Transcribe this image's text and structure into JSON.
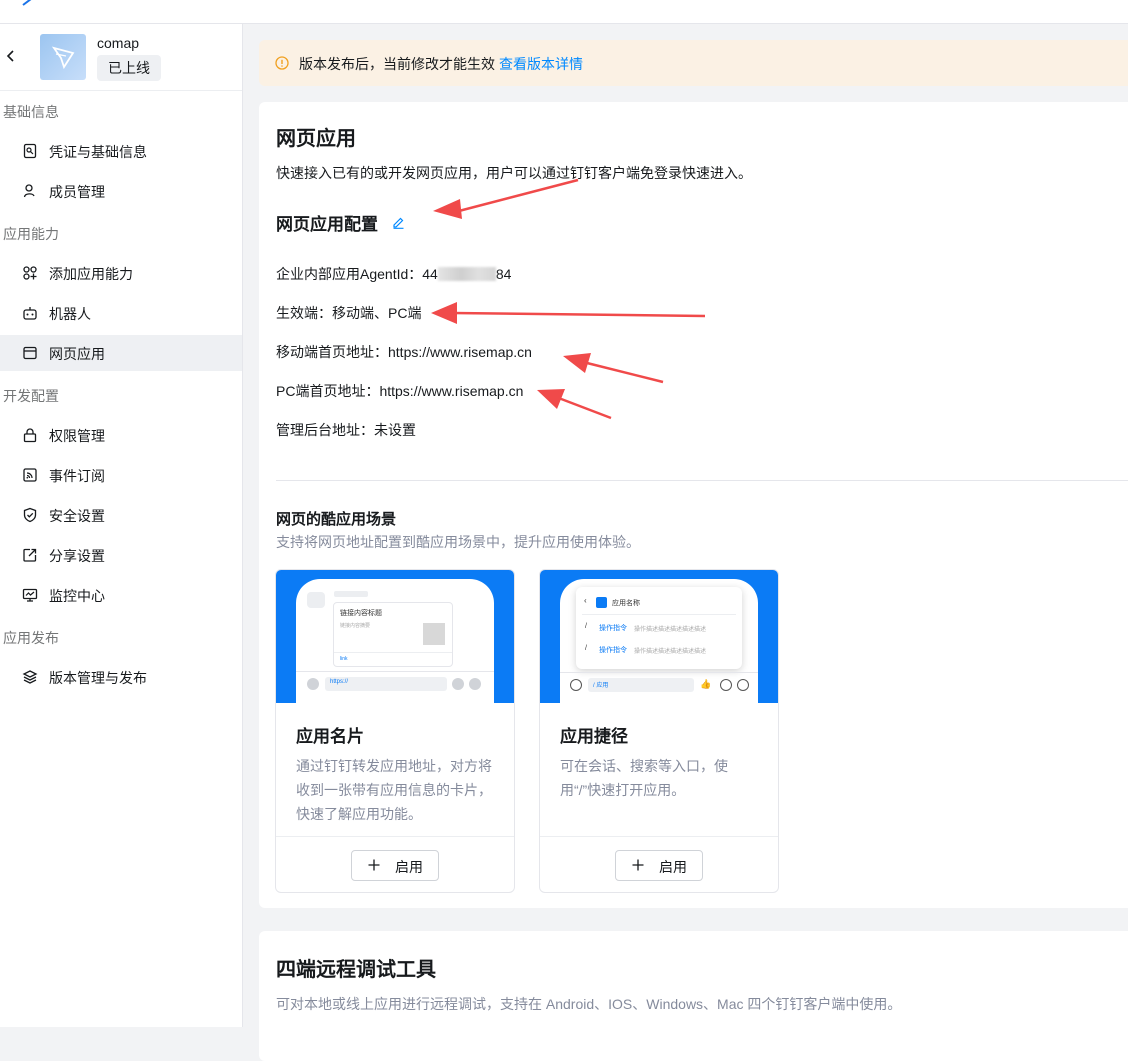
{
  "app": {
    "name": "comap",
    "status": "已上线"
  },
  "sidebar": {
    "sections": [
      {
        "title": "基础信息",
        "items": [
          {
            "label": "凭证与基础信息",
            "icon": "credential-icon"
          },
          {
            "label": "成员管理",
            "icon": "member-icon"
          }
        ]
      },
      {
        "title": "应用能力",
        "items": [
          {
            "label": "添加应用能力",
            "icon": "add-capability-icon"
          },
          {
            "label": "机器人",
            "icon": "robot-icon"
          },
          {
            "label": "网页应用",
            "icon": "web-app-icon",
            "active": true
          }
        ]
      },
      {
        "title": "开发配置",
        "items": [
          {
            "label": "权限管理",
            "icon": "lock-icon"
          },
          {
            "label": "事件订阅",
            "icon": "rss-icon"
          },
          {
            "label": "安全设置",
            "icon": "shield-icon"
          },
          {
            "label": "分享设置",
            "icon": "share-icon"
          },
          {
            "label": "监控中心",
            "icon": "monitor-icon"
          }
        ]
      },
      {
        "title": "应用发布",
        "items": [
          {
            "label": "版本管理与发布",
            "icon": "layers-icon"
          }
        ]
      }
    ]
  },
  "banner": {
    "text": "版本发布后，当前修改才能生效",
    "link": "查看版本详情"
  },
  "web_app": {
    "title": "网页应用",
    "description": "快速接入已有的或开发网页应用，用户可以通过钉钉客户端免登录快速进入。",
    "config_title": "网页应用配置",
    "agent_id_label": "企业内部应用AgentId：",
    "agent_id_prefix": "44",
    "agent_id_suffix": "84",
    "platform": "生效端：移动端、PC端",
    "mobile_url": "移动端首页地址：https://www.risemap.cn",
    "pc_url": "PC端首页地址：https://www.risemap.cn",
    "admin_url": "管理后台地址：未设置"
  },
  "cool_app": {
    "title": "网页的酷应用场景",
    "description": "支持将网页地址配置到酷应用场景中，提升应用使用体验。",
    "cards": [
      {
        "title": "应用名片",
        "description": "通过钉钉转发应用地址，对方将收到一张带有应用信息的卡片，快速了解应用功能。",
        "button": "启用",
        "preview": {
          "card_title": "链接内容标题",
          "card_summary": "链接内容摘要",
          "card_link": "link",
          "input": "https://"
        }
      },
      {
        "title": "应用捷径",
        "description": "可在会话、搜索等入口，使用“/”快速打开应用。",
        "button": "启用",
        "preview": {
          "app_name": "应用名称",
          "cmd1": "操作指令",
          "cmd1_desc": "操作描述描述描述描述描述",
          "cmd2": "操作指令",
          "cmd2_desc": "操作描述描述描述描述描述",
          "input": "/ 应用",
          "slash": "/"
        }
      }
    ]
  },
  "debug_tool": {
    "title": "四端远程调试工具",
    "description": "可对本地或线上应用进行远程调试，支持在 Android、IOS、Windows、Mac 四个钉钉客户端中使用。"
  },
  "colors": {
    "accent": "#0089ff",
    "preview_blue": "#0b7bf5",
    "active_bg": "#eef0f3",
    "banner_bg": "#fbf1e4",
    "annotation_arrow": "#f04a4a"
  }
}
